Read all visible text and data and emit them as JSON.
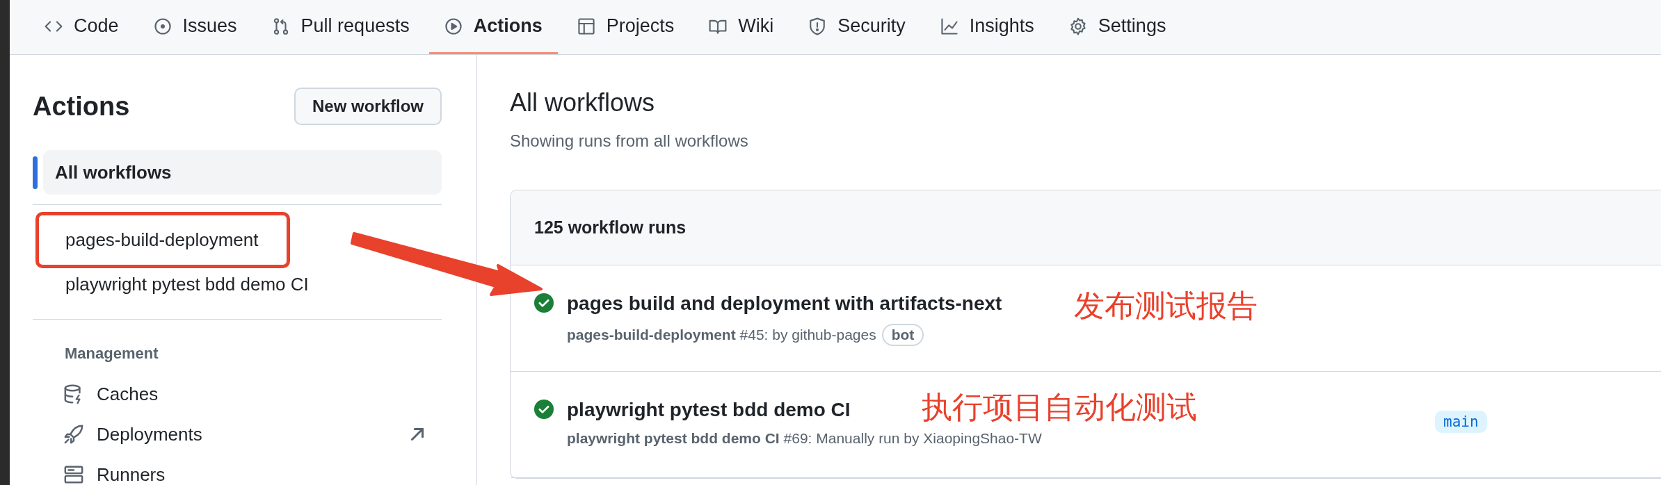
{
  "tabs": [
    {
      "label": "Code",
      "selected": false
    },
    {
      "label": "Issues",
      "selected": false
    },
    {
      "label": "Pull requests",
      "selected": false
    },
    {
      "label": "Actions",
      "selected": true
    },
    {
      "label": "Projects",
      "selected": false
    },
    {
      "label": "Wiki",
      "selected": false
    },
    {
      "label": "Security",
      "selected": false
    },
    {
      "label": "Insights",
      "selected": false
    },
    {
      "label": "Settings",
      "selected": false
    }
  ],
  "sidebar": {
    "title": "Actions",
    "new_button": "New workflow",
    "workflows": [
      {
        "label": "All workflows",
        "selected": true,
        "highlighted": false
      },
      {
        "label": "pages-build-deployment",
        "selected": false,
        "highlighted": true
      },
      {
        "label": "playwright pytest bdd demo CI",
        "selected": false,
        "highlighted": false
      }
    ],
    "management_heading": "Management",
    "management": [
      {
        "label": "Caches",
        "external": false
      },
      {
        "label": "Deployments",
        "external": true
      },
      {
        "label": "Runners",
        "external": false
      }
    ]
  },
  "main": {
    "title": "All workflows",
    "subtitle": "Showing runs from all workflows",
    "count": "125 workflow runs",
    "runs": [
      {
        "succeeded": true,
        "title": "pages build and deployment with artifacts-next",
        "workflow": "pages-build-deployment",
        "detail": "#45: by github-pages",
        "badge": "bot"
      },
      {
        "succeeded": true,
        "title": "playwright pytest bdd demo CI",
        "workflow": "playwright pytest bdd demo CI",
        "detail": "#69: Manually run by XiaopingShao-TW",
        "branch": "main"
      }
    ]
  },
  "annotations": [
    {
      "text": "发布测试报告"
    },
    {
      "text": "执行项目自动化测试"
    }
  ]
}
